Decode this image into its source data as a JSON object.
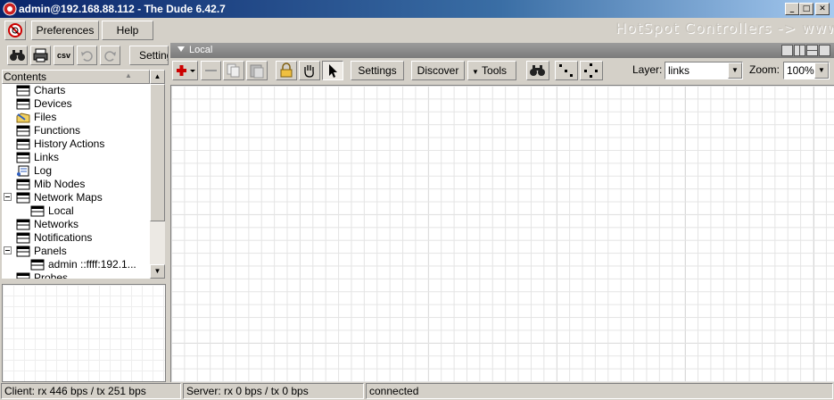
{
  "window": {
    "title": "admin@192.168.88.112 - The Dude 6.42.7"
  },
  "caption_buttons": {
    "minimize": "_",
    "maximize": "□",
    "close": "✕"
  },
  "menu": {
    "preferences": "Preferences",
    "help": "Help",
    "settings_partial": "Setting"
  },
  "banner": "HotSpot Controllers -> www",
  "left_toolbar": {
    "csv": "csv"
  },
  "contents": {
    "header": "Contents",
    "items": [
      {
        "label": "Charts",
        "icon": "table-icon"
      },
      {
        "label": "Devices",
        "icon": "table-icon"
      },
      {
        "label": "Files",
        "icon": "files-icon"
      },
      {
        "label": "Functions",
        "icon": "table-icon"
      },
      {
        "label": "History Actions",
        "icon": "table-icon"
      },
      {
        "label": "Links",
        "icon": "table-icon"
      },
      {
        "label": "Log",
        "icon": "log-icon"
      },
      {
        "label": "Mib Nodes",
        "icon": "table-icon"
      },
      {
        "label": "Network Maps",
        "icon": "table-icon"
      },
      {
        "label": "Local",
        "icon": "table-icon"
      },
      {
        "label": "Networks",
        "icon": "table-icon"
      },
      {
        "label": "Notifications",
        "icon": "table-icon"
      },
      {
        "label": "Panels",
        "icon": "table-icon"
      },
      {
        "label": "admin ::ffff:192.1...",
        "icon": "table-icon"
      },
      {
        "label": "Probes",
        "icon": "table-icon"
      }
    ]
  },
  "map": {
    "title": "Local",
    "toolbar": {
      "settings": "Settings",
      "discover": "Discover",
      "tools": "Tools",
      "layer_label": "Layer:",
      "layer_value": "links",
      "zoom_label": "Zoom:",
      "zoom_value": "100%"
    }
  },
  "status": {
    "client": "Client: rx 446 bps / tx 251 bps",
    "server": "Server: rx 0 bps / tx 0 bps",
    "connection": "connected"
  },
  "colors": {
    "titlebar": "#0a246a",
    "face": "#d4d0c8",
    "add_red": "#cc0000"
  }
}
